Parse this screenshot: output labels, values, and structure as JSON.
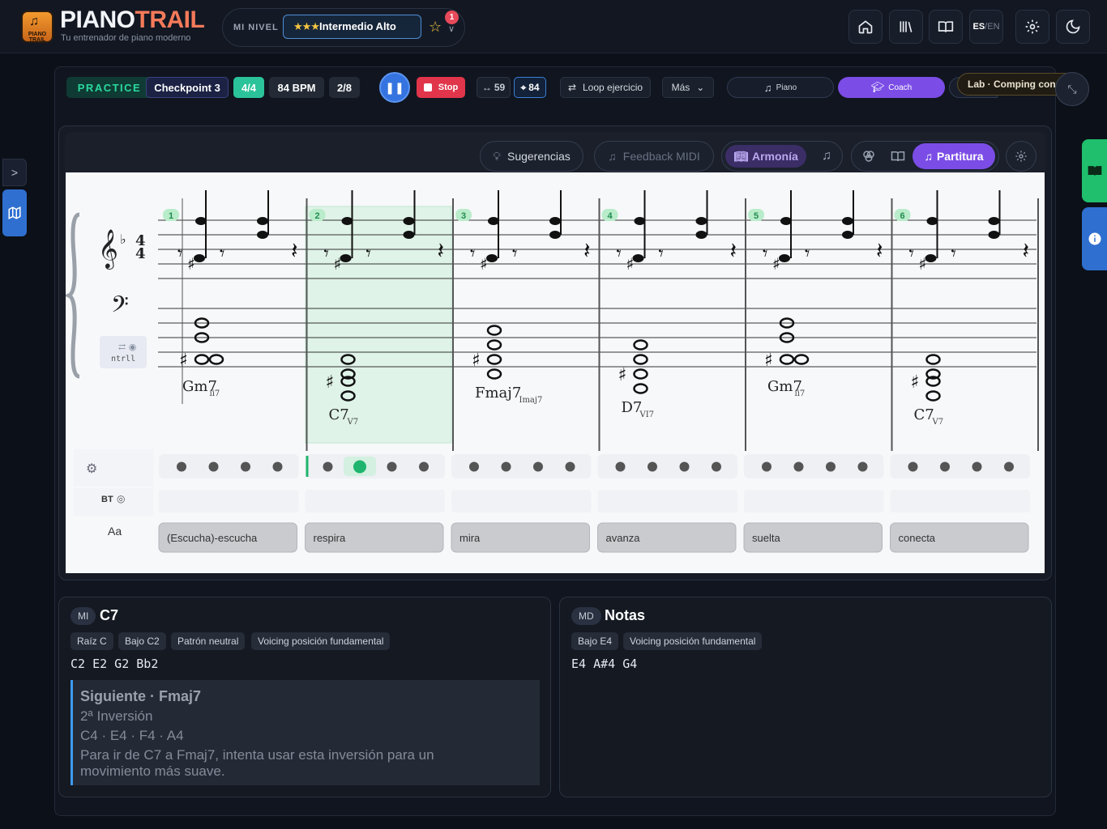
{
  "app": {
    "logo_part1": "PIANO",
    "logo_part2": "TRAIL",
    "subtitle": "Tu entrenador de piano moderno",
    "badge_text": "PIANO TRAIL"
  },
  "level": {
    "label": "MI NIVEL",
    "stars": "★★★",
    "name": "Intermedio Alto",
    "notifications": "1"
  },
  "top_nav": {
    "lang_active": "ES",
    "lang_sep": "/",
    "lang_other": "EN",
    "icons": [
      "home-icon",
      "library-icon",
      "book-icon",
      "language-toggle",
      "settings-icon",
      "moon-icon"
    ]
  },
  "toolbar": {
    "mode": "PRACTICE",
    "checkpoint": "Checkpoint 3",
    "time_signature": "4/4",
    "tempo": "84 BPM",
    "progress": "2/8",
    "stop": "Stop",
    "range_value": "59",
    "target_value": "84",
    "loop": "Loop ejercicio",
    "more": "Más",
    "piano": "Piano",
    "coach": "Coach",
    "lab": "Lab · Comping con aire"
  },
  "score_header": {
    "suggestions": "Sugerencias",
    "feedback": "Feedback MIDI",
    "harmony": "Armonía",
    "score": "Partitura"
  },
  "score": {
    "key_signature": "F major (1 flat)",
    "time_signature": "4/4",
    "measures": [
      {
        "number": "1",
        "chord": "Gm7",
        "roman": "ii7"
      },
      {
        "number": "2",
        "chord": "C7",
        "roman": "V7"
      },
      {
        "number": "3",
        "chord": "Fmaj7",
        "roman": "Imaj7"
      },
      {
        "number": "4",
        "chord": "D7",
        "roman": "VI7"
      },
      {
        "number": "5",
        "chord": "Gm7",
        "roman": "ii7"
      },
      {
        "number": "6",
        "chord": "C7",
        "roman": "V7"
      }
    ],
    "active_measure": 2,
    "active_beat": 2,
    "beats_per_measure": 4,
    "control_label": "ntrll",
    "bt_label": "BT",
    "lyrics_label": "Aa",
    "lyrics": [
      "(Escucha)-escucha",
      "respira",
      "mira",
      "avanza",
      "suelta",
      "conecta"
    ]
  },
  "current_panel": {
    "hand": "MI",
    "chord": "C7",
    "chips": [
      "Raíz C",
      "Bajo C2",
      "Patrón neutral",
      "Voicing posición fundamental"
    ],
    "notes": "C2 E2 G2 Bb2",
    "next_title": "Siguiente · Fmaj7",
    "next_inversion": "2ª Inversión",
    "next_notes": "C4 · E4 · F4 · A4",
    "next_tip_1": "Para ir de C7 a Fmaj7, intenta usar esta inversión para un",
    "next_tip_2": "movimiento más suave."
  },
  "notes_panel": {
    "hand": "MD",
    "title": "Notas",
    "chips": [
      "Bajo E4",
      "Voicing posición fundamental"
    ],
    "notes": "E4 A#4 G4"
  },
  "side": {
    "collapse": ">"
  },
  "colors": {
    "accent_purple": "#7b4de6",
    "accent_blue": "#3574e0",
    "accent_green": "#2bc39a",
    "stop_red": "#e0354a",
    "brand_orange": "#f47a5a"
  }
}
